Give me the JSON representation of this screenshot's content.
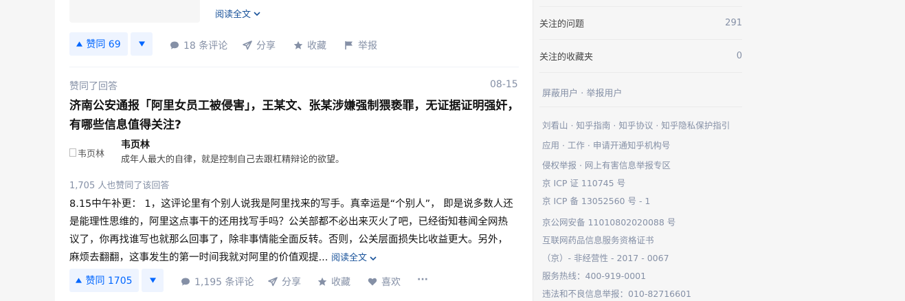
{
  "feed": {
    "prev_item": {
      "read_more": "阅读全文",
      "vote_up": "赞同 69",
      "comments": "18 条评论",
      "share": "分享",
      "collect": "收藏",
      "report": "举报"
    },
    "item": {
      "action_label": "赞同了回答",
      "date": "08-15",
      "title": "济南公安通报「阿里女员工被侵害」，王某文、张某涉嫌强制猥亵罪，无证据证明强奸，有哪些信息值得关注?",
      "author": {
        "avatar_alt": "韦页林",
        "name": "韦页林",
        "headline": "成年人最大的自律，就是控制自己去跟杠精辩论的欲望。"
      },
      "upvote_summary": "1,705 人也赞同了该回答",
      "excerpt": "8.15中午补更： 1，这评论里有个别人说我是阿里找来的写手。真幸运是“个别人”， 即是说多数人还是能理性思维的，阿里这点事干的还用找写手吗？公关部都不必出来灭火了吧，已经街知巷闻全网热议了，你再找谁写也就那么回事了，除非事情能全面反转。否则，公关层面损失比收益更大。另外，麻烦去翻翻，这事发生的第一时间我就对阿里的价值观提...",
      "read_more": "阅读全文",
      "vote_up": "赞同 1705",
      "comments": "1,195 条评论",
      "share": "分享",
      "collect": "收藏",
      "like": "喜欢",
      "more": "···"
    }
  },
  "sidebar": {
    "followed_questions_label": "关注的问题",
    "followed_questions_count": "291",
    "followed_collections_label": "关注的收藏夹",
    "followed_collections_count": "0",
    "block_user": "屏蔽用户",
    "report_user": "举报用户",
    "footer_line1": "刘看山 · 知乎指南 · 知乎协议 · 知乎隐私保护指引",
    "footer_line2": "应用 · 工作 · 申请开通知乎机构号",
    "footer_line3": "侵权举报 · 网上有害信息举报专区",
    "icp1": "京 ICP 证 110745 号",
    "icp2": "京 ICP 备 13052560 号 - 1",
    "police": " 京公网安备 11010802020088 号",
    "drug_info": "互联网药品信息服务资格证书",
    "drug_info2": "（京）- 非经营性 - 2017 - 0067",
    "hotline": "服务热线：400-919-0001",
    "illegal_report": "违法和不良信息举报：010-82716601"
  },
  "colors": {
    "accent": "#0066ff",
    "vote_bg": "#eef4ff",
    "link": "#175199",
    "muted": "#8590a6"
  }
}
